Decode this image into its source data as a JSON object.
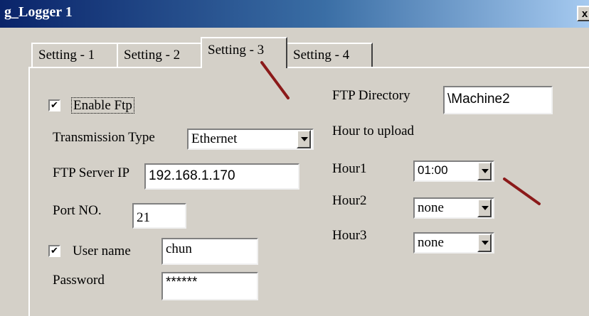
{
  "window": {
    "title": "g_Logger 1",
    "close_glyph": "x"
  },
  "tabs": [
    {
      "label": "Setting - 1",
      "active": false
    },
    {
      "label": "Setting - 2",
      "active": false
    },
    {
      "label": "Setting - 3",
      "active": true
    },
    {
      "label": "Setting - 4",
      "active": false
    }
  ],
  "ftp": {
    "enable_label": "Enable Ftp",
    "enable_checked": true,
    "transmission_label": "Transmission Type",
    "transmission_value": "Ethernet",
    "server_ip_label": "FTP Server IP",
    "server_ip_value": "192.168.1.170",
    "port_label": "Port NO.",
    "port_value": "21",
    "username_label": "User name",
    "username_checked": true,
    "username_value": "chun",
    "password_label": "Password",
    "password_value": "******",
    "directory_label": "FTP Directory",
    "directory_value": "\\Machine2",
    "hour_upload_label": "Hour to upload",
    "hours": [
      {
        "label": "Hour1",
        "value": "01:00"
      },
      {
        "label": "Hour2",
        "value": "none"
      },
      {
        "label": "Hour3",
        "value": "none"
      }
    ]
  },
  "colors": {
    "annotation": "#8b1a1a",
    "face": "#d4d0c8",
    "titlebar": "#0a246a"
  },
  "icons": {
    "checkbox": "check-mark",
    "dropdown": "chevron-down-icon",
    "close": "close-icon"
  }
}
